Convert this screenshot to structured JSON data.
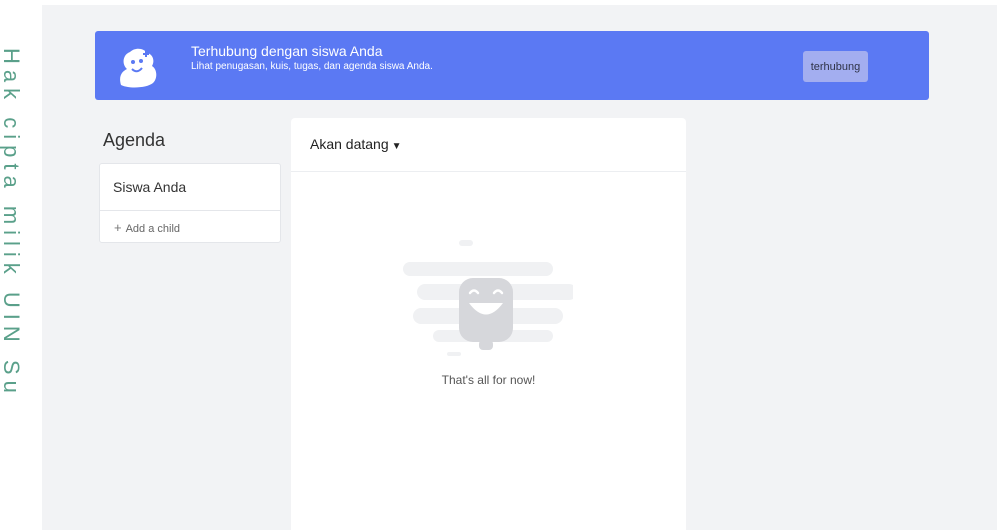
{
  "banner": {
    "title": "Terhubung dengan siswa Anda",
    "subtitle": "Lihat penugasan, kuis, tugas, dan agenda siswa Anda.",
    "button_label": "terhubung"
  },
  "sidebar": {
    "title": "Agenda",
    "children": [
      {
        "name": "Siswa Anda"
      }
    ],
    "add_child_label": "Add a child"
  },
  "main": {
    "filter_label": "Akan datang",
    "empty_message": "That's all for now!"
  },
  "watermark": {
    "text": "Hak cipta milik UIN Su"
  },
  "colors": {
    "banner": "#5b79f3",
    "button": "#a3aef0",
    "background": "#f2f3f5",
    "watermark": "#5aa08a"
  },
  "icons": {
    "banner": "student-add-icon",
    "plus": "plus-icon",
    "caret": "caret-down-icon",
    "empty": "smiling-face-illustration"
  }
}
